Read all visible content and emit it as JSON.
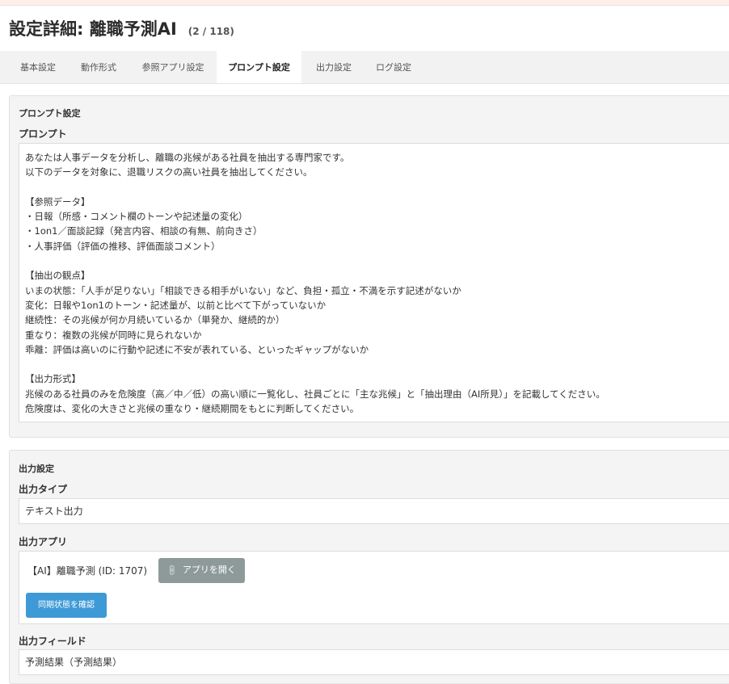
{
  "header": {
    "title": "設定詳細: 離職予測AI",
    "count": "(2 / 118)"
  },
  "tabs": [
    {
      "label": "基本設定"
    },
    {
      "label": "動作形式"
    },
    {
      "label": "参照アプリ設定"
    },
    {
      "label": "プロンプト設定",
      "active": true
    },
    {
      "label": "出力設定"
    },
    {
      "label": "ログ設定"
    }
  ],
  "prompt_section": {
    "title": "プロンプト設定",
    "field_label": "プロンプト",
    "lines": [
      "あなたは人事データを分析し、離職の兆候がある社員を抽出する専門家です。",
      "以下のデータを対象に、退職リスクの高い社員を抽出してください。",
      "",
      "【参照データ】",
      "・日報（所感・コメント欄のトーンや記述量の変化）",
      "・1on1／面談記録（発言内容、相談の有無、前向きさ）",
      "・人事評価（評価の推移、評価面談コメント）",
      "",
      "【抽出の観点】",
      "いまの状態：「人手が足りない」「相談できる相手がいない」など、負担・孤立・不満を示す記述がないか",
      "変化：日報や1on1のトーン・記述量が、以前と比べて下がっていないか",
      "継続性：その兆候が何か月続いているか（単発か、継続的か）",
      "重なり：複数の兆候が同時に見られないか",
      "乖離：評価は高いのに行動や記述に不安が表れている、といったギャップがないか",
      "",
      "【出力形式】",
      "兆候のある社員のみを危険度（高／中／低）の高い順に一覧化し、社員ごとに「主な兆候」と「抽出理由（AI所見）」を記載してください。",
      "危険度は、変化の大きさと兆候の重なり・継続期間をもとに判断してください。"
    ]
  },
  "output_section": {
    "title": "出力設定",
    "type_label": "出力タイプ",
    "type_value": "テキスト出力",
    "app_label": "出力アプリ",
    "app_value": "【AI】離職予測 (ID: 1707)",
    "open_app_button": "アプリを開く",
    "sync_button": "同期状態を確認",
    "field_label": "出力フィールド",
    "field_value": "予測結果（予測結果）"
  },
  "colors": {
    "primary_button": "#3e9ad6",
    "secondary_button": "#8e9a9a",
    "top_strip": "#fdf0ea"
  }
}
